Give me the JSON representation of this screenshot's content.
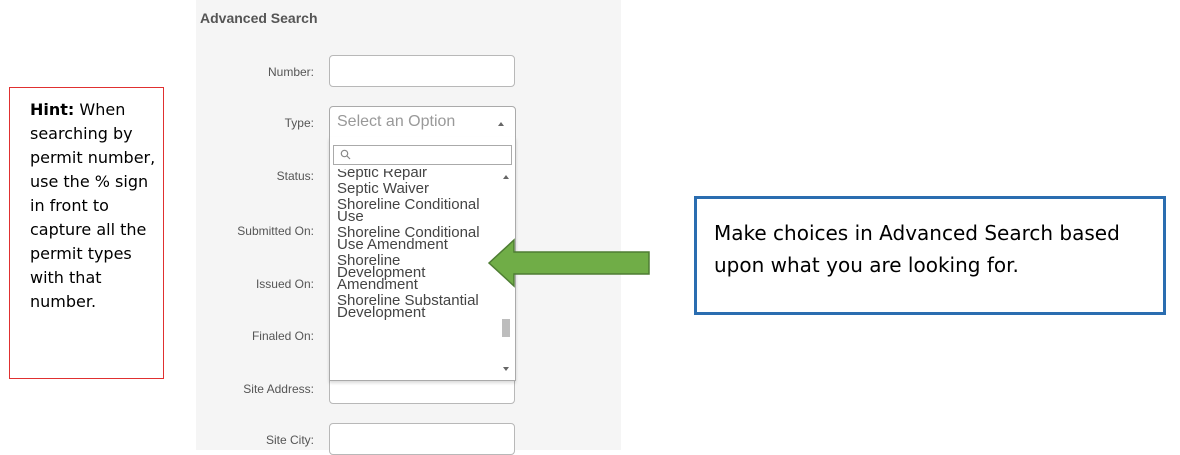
{
  "hint": {
    "bold": "Hint:",
    "text": "When searching by permit number, use the % sign in front to capture all the permit types with that number."
  },
  "form": {
    "title": "Advanced Search",
    "labels": {
      "number": "Number:",
      "type": "Type:",
      "status": "Status:",
      "submitted_on": "Submitted On:",
      "issued_on": "Issued On:",
      "finaled_on": "Finaled On:",
      "site_address": "Site Address:",
      "site_city": "Site City:"
    },
    "type_select": {
      "placeholder": "Select an Option",
      "options": [
        "Septic Repair",
        "Septic Waiver",
        "Shoreline Conditional Use",
        "Shoreline Conditional Use Amendment",
        "Shoreline Development Amendment",
        "Shoreline Substantial Development"
      ]
    }
  },
  "note": "Make choices in Advanced Search based upon what you are looking for.",
  "colors": {
    "panel_bg": "#f5f5f5",
    "hint_border": "#e03030",
    "note_border": "#2a6db0",
    "arrow_fill": "#70ad47",
    "arrow_stroke": "#4e7d33"
  }
}
